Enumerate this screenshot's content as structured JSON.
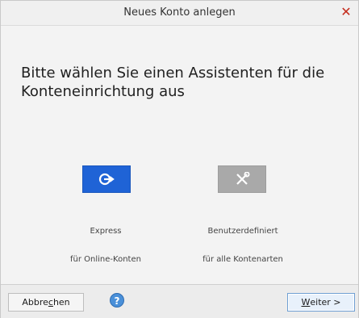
{
  "window": {
    "title": "Neues Konto anlegen"
  },
  "main": {
    "heading": "Bitte wählen Sie einen Assistenten für die Konteneinrichtung aus",
    "options": [
      {
        "title": "Express",
        "subtitle": "für Online-Konten",
        "icon": "arrow-login-icon",
        "color": "#1f63d6"
      },
      {
        "title": "Benutzerdefiniert",
        "subtitle": "für alle Kontenarten",
        "icon": "tools-icon",
        "color": "#a9a9a9"
      }
    ]
  },
  "footer": {
    "cancel": {
      "pre": "Abbre",
      "mnemonic": "c",
      "post": "hen"
    },
    "help_icon": "help-icon",
    "next": {
      "mnemonic": "W",
      "post": "eiter >"
    }
  }
}
